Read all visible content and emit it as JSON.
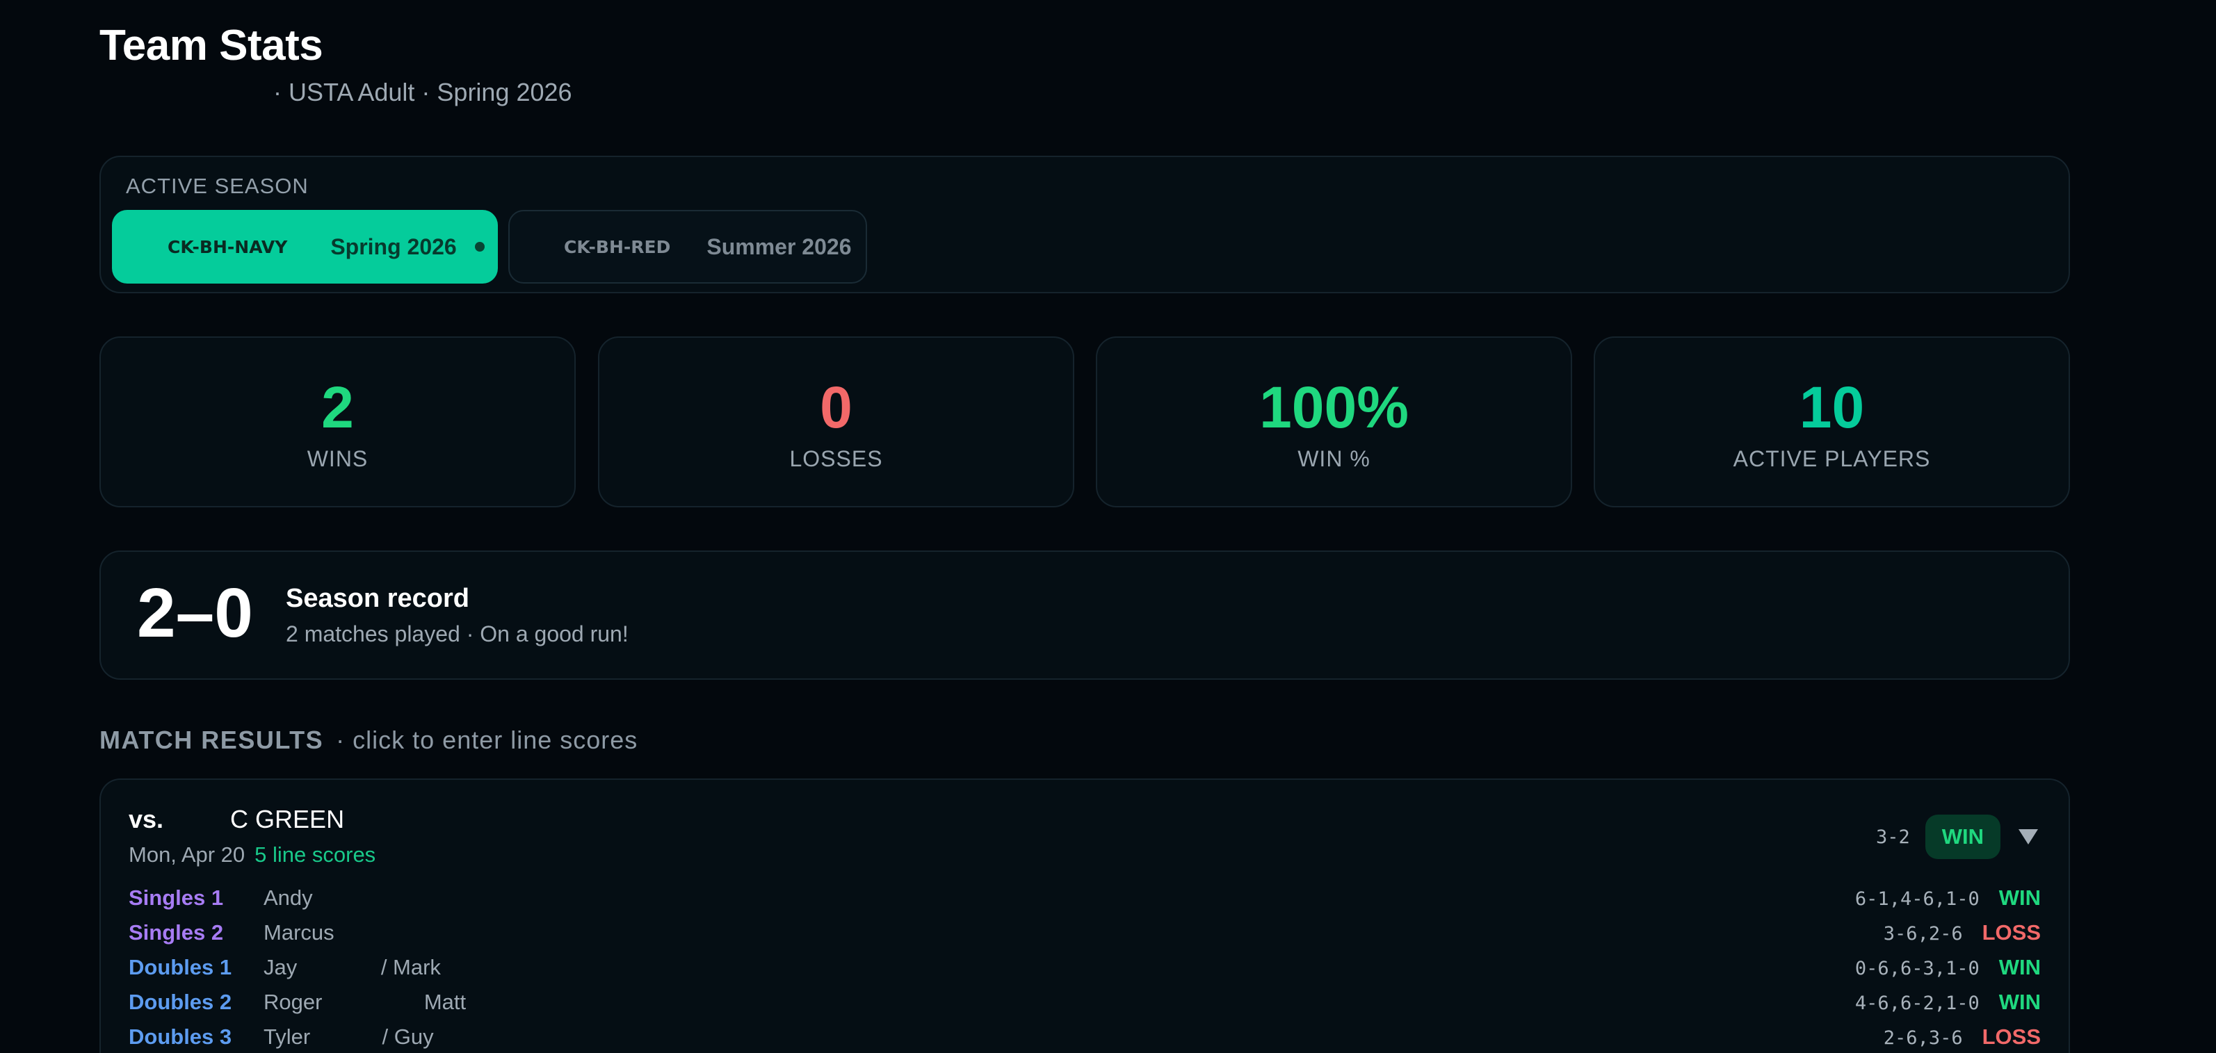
{
  "header": {
    "title": "Team Stats",
    "subtitle": "· USTA Adult · Spring 2026"
  },
  "season": {
    "label": "ACTIVE SEASON",
    "options": [
      {
        "code": "CK-BH-NAVY",
        "name": "Spring 2026",
        "active": true
      },
      {
        "code": "CK-BH-RED",
        "name": "Summer 2026",
        "active": false
      }
    ]
  },
  "stats": [
    {
      "value": "2",
      "label": "WINS",
      "color": "#1fd87f"
    },
    {
      "value": "0",
      "label": "LOSSES",
      "color": "#f26969"
    },
    {
      "value": "100%",
      "label": "WIN %",
      "color": "#1fd87f"
    },
    {
      "value": "10",
      "label": "ACTIVE PLAYERS",
      "color": "#05cc9b"
    }
  ],
  "record": {
    "score": "2–0",
    "title": "Season record",
    "subtitle": "2 matches played · On a good run!"
  },
  "match_results": {
    "heading": "MATCH RESULTS",
    "hint": "· click to enter line scores",
    "matches": [
      {
        "vs_label": "vs.",
        "opponent": "C GREEN",
        "date": "Mon, Apr 20",
        "line_count": "5 line scores",
        "score": "3-2",
        "result": "WIN",
        "lines": [
          {
            "position": "Singles 1",
            "type": "singles",
            "players": "Andy",
            "score": "6-1,4-6,1-0",
            "result": "WIN"
          },
          {
            "position": "Singles 2",
            "type": "singles",
            "players": "Marcus",
            "score": "3-6,2-6",
            "result": "LOSS"
          },
          {
            "position": "Doubles 1",
            "type": "doubles",
            "players": "Jay              / Mark",
            "score": "0-6,6-3,1-0",
            "result": "WIN"
          },
          {
            "position": "Doubles 2",
            "type": "doubles",
            "players": "Roger                 Matt",
            "score": "4-6,6-2,1-0",
            "result": "WIN"
          },
          {
            "position": "Doubles 3",
            "type": "doubles",
            "players": "Tyler            / Guy",
            "score": "2-6,3-6",
            "result": "LOSS"
          }
        ]
      }
    ]
  },
  "colors": {
    "accent": "#05cc9b",
    "win": "#1fd87f",
    "loss": "#f26969",
    "singles": "#a77cf4",
    "doubles": "#5d9cf0"
  }
}
